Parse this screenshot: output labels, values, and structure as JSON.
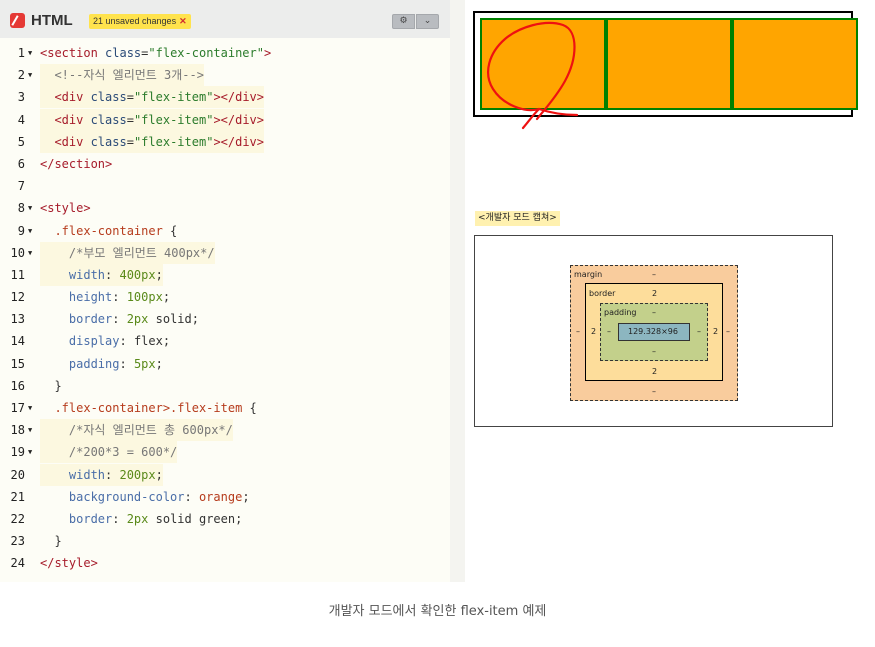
{
  "editor": {
    "language_label": "HTML",
    "unsaved_label": "21 unsaved changes",
    "unsaved_close": "✕",
    "settings_icon": "gear-icon",
    "collapse_icon": "chevron-down-icon",
    "lines": [
      {
        "n": "1",
        "fold": true,
        "hl": false,
        "tokens": [
          [
            "tag",
            "<section"
          ],
          [
            "attr",
            " class"
          ],
          [
            "punc",
            "="
          ],
          [
            "str",
            "\"flex-container\""
          ],
          [
            "tag",
            ">"
          ]
        ]
      },
      {
        "n": "2",
        "fold": true,
        "hl": true,
        "tokens": [
          [
            "cmt",
            "  <!--자식 엘리먼트 3개-->"
          ]
        ]
      },
      {
        "n": "3",
        "fold": false,
        "hl": true,
        "tokens": [
          [
            "tag",
            "  <div"
          ],
          [
            "attr",
            " class"
          ],
          [
            "punc",
            "="
          ],
          [
            "str",
            "\"flex-item\""
          ],
          [
            "tag",
            "></div>"
          ]
        ]
      },
      {
        "n": "4",
        "fold": false,
        "hl": true,
        "tokens": [
          [
            "tag",
            "  <div"
          ],
          [
            "attr",
            " class"
          ],
          [
            "punc",
            "="
          ],
          [
            "str",
            "\"flex-item\""
          ],
          [
            "tag",
            "></div>"
          ]
        ]
      },
      {
        "n": "5",
        "fold": false,
        "hl": true,
        "tokens": [
          [
            "tag",
            "  <div"
          ],
          [
            "attr",
            " class"
          ],
          [
            "punc",
            "="
          ],
          [
            "str",
            "\"flex-item\""
          ],
          [
            "tag",
            "></div>"
          ]
        ]
      },
      {
        "n": "6",
        "fold": false,
        "hl": false,
        "tokens": [
          [
            "tag",
            "</section>"
          ]
        ]
      },
      {
        "n": "7",
        "fold": false,
        "hl": false,
        "tokens": []
      },
      {
        "n": "8",
        "fold": true,
        "hl": false,
        "tokens": [
          [
            "tag",
            "<style>"
          ]
        ]
      },
      {
        "n": "9",
        "fold": true,
        "hl": false,
        "tokens": [
          [
            "sel",
            "  .flex-container"
          ],
          [
            "punc",
            " {"
          ]
        ]
      },
      {
        "n": "10",
        "fold": true,
        "hl": true,
        "tokens": [
          [
            "cmt",
            "    /*부모 엘리먼트 400px*/"
          ]
        ]
      },
      {
        "n": "11",
        "fold": false,
        "hl": true,
        "tokens": [
          [
            "prop",
            "    width"
          ],
          [
            "punc",
            ": "
          ],
          [
            "num",
            "400px"
          ],
          [
            "punc",
            ";"
          ]
        ]
      },
      {
        "n": "12",
        "fold": false,
        "hl": false,
        "tokens": [
          [
            "prop",
            "    height"
          ],
          [
            "punc",
            ": "
          ],
          [
            "num",
            "100px"
          ],
          [
            "punc",
            ";"
          ]
        ]
      },
      {
        "n": "13",
        "fold": false,
        "hl": false,
        "tokens": [
          [
            "prop",
            "    border"
          ],
          [
            "punc",
            ": "
          ],
          [
            "num",
            "2px"
          ],
          [
            "kw",
            " solid"
          ],
          [
            "punc",
            ";"
          ]
        ]
      },
      {
        "n": "14",
        "fold": false,
        "hl": false,
        "tokens": [
          [
            "prop",
            "    display"
          ],
          [
            "punc",
            ": "
          ],
          [
            "kw",
            "flex"
          ],
          [
            "punc",
            ";"
          ]
        ]
      },
      {
        "n": "15",
        "fold": false,
        "hl": false,
        "tokens": [
          [
            "prop",
            "    padding"
          ],
          [
            "punc",
            ": "
          ],
          [
            "num",
            "5px"
          ],
          [
            "punc",
            ";"
          ]
        ]
      },
      {
        "n": "16",
        "fold": false,
        "hl": false,
        "tokens": [
          [
            "punc",
            "  }"
          ]
        ]
      },
      {
        "n": "17",
        "fold": true,
        "hl": false,
        "tokens": [
          [
            "sel",
            "  .flex-container>.flex-item"
          ],
          [
            "punc",
            " {"
          ]
        ]
      },
      {
        "n": "18",
        "fold": true,
        "hl": true,
        "tokens": [
          [
            "cmt",
            "    /*자식 엘리먼트 총 600px*/"
          ]
        ]
      },
      {
        "n": "19",
        "fold": true,
        "hl": true,
        "tokens": [
          [
            "cmt",
            "    /*200*3 = 600*/"
          ]
        ]
      },
      {
        "n": "20",
        "fold": false,
        "hl": true,
        "tokens": [
          [
            "prop",
            "    width"
          ],
          [
            "punc",
            ": "
          ],
          [
            "num",
            "200px"
          ],
          [
            "punc",
            ";"
          ]
        ]
      },
      {
        "n": "21",
        "fold": false,
        "hl": false,
        "tokens": [
          [
            "prop",
            "    background-color"
          ],
          [
            "punc",
            ": "
          ],
          [
            "sel",
            "orange"
          ],
          [
            "punc",
            ";"
          ]
        ]
      },
      {
        "n": "22",
        "fold": false,
        "hl": false,
        "tokens": [
          [
            "prop",
            "    border"
          ],
          [
            "punc",
            ": "
          ],
          [
            "num",
            "2px"
          ],
          [
            "kw",
            " solid"
          ],
          [
            "kw",
            " green"
          ],
          [
            "punc",
            ";"
          ]
        ]
      },
      {
        "n": "23",
        "fold": false,
        "hl": false,
        "tokens": [
          [
            "punc",
            "  }"
          ]
        ]
      },
      {
        "n": "24",
        "fold": false,
        "hl": false,
        "tokens": [
          [
            "tag",
            "</style>"
          ]
        ]
      }
    ]
  },
  "preview": {
    "item_color": "#ffa500",
    "item_border_color": "#008000"
  },
  "capture_label": "<개발자 모드 캡쳐>",
  "box_model": {
    "margin_label": "margin",
    "margin_top": "–",
    "margin_bottom": "–",
    "margin_left": "–",
    "margin_right": "–",
    "border_label": "border",
    "border_top": "2",
    "border_bottom": "2",
    "border_left": "2",
    "border_right": "2",
    "padding_label": "padding",
    "padding_top": "–",
    "padding_bottom": "–",
    "padding_left": "–",
    "padding_right": "–",
    "content_size": "129.328×96"
  },
  "caption": "개발자 모드에서 확인한 flex-item 예제"
}
